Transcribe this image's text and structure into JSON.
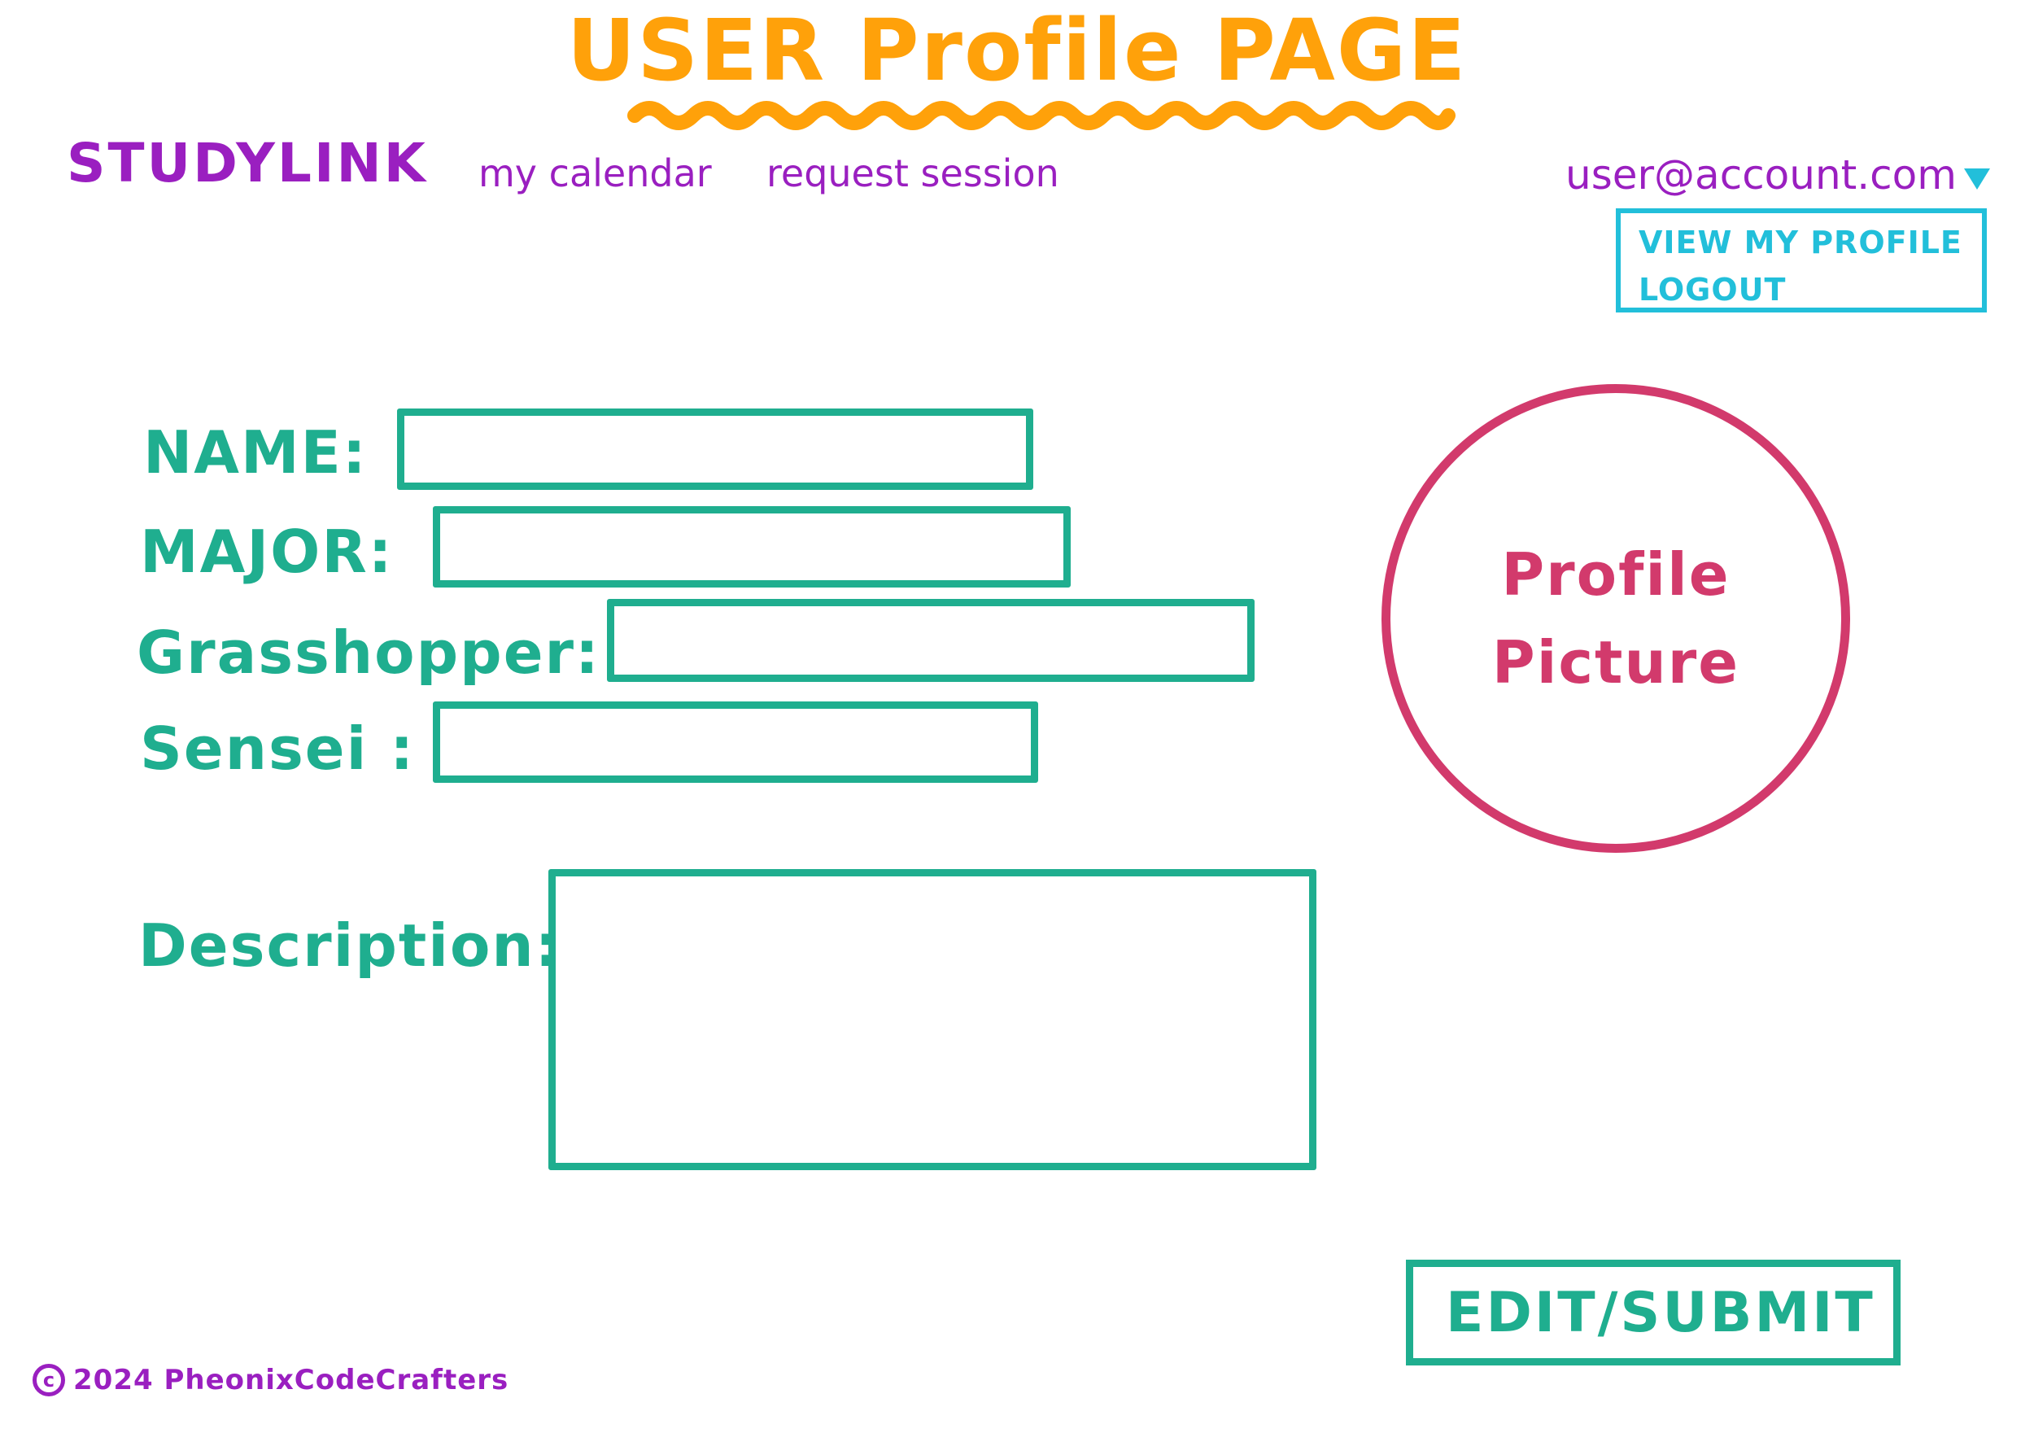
{
  "header": {
    "title": "USER Profile PAGE"
  },
  "nav": {
    "brand": "STUDYLINK",
    "items": [
      {
        "label": "my calendar"
      },
      {
        "label": "request session"
      }
    ]
  },
  "account": {
    "email": "user@account.com",
    "dropdown_icon": "caret-down-icon",
    "menu": [
      {
        "label": "VIEW MY PROFILE"
      },
      {
        "label": "LOGOUT"
      }
    ]
  },
  "form": {
    "name": {
      "label": "NAME:",
      "value": ""
    },
    "major": {
      "label": "MAJOR:",
      "value": ""
    },
    "grasshopper": {
      "label": "Grasshopper:",
      "value": ""
    },
    "sensei": {
      "label": "Sensei :",
      "value": ""
    },
    "description": {
      "label": "Description:",
      "value": ""
    }
  },
  "profile_picture": {
    "line1": "Profile",
    "line2": "Picture"
  },
  "actions": {
    "edit_submit": "EDIT/SUBMIT"
  },
  "footer": {
    "copyright_symbol": "c",
    "text": "2024 PheonixCodeCrafters"
  },
  "colors": {
    "title": "#FFA10A",
    "nav": "#9A1FC0",
    "menu": "#22BFDA",
    "form": "#1FAE8F",
    "profile_picture": "#D23A6C"
  }
}
